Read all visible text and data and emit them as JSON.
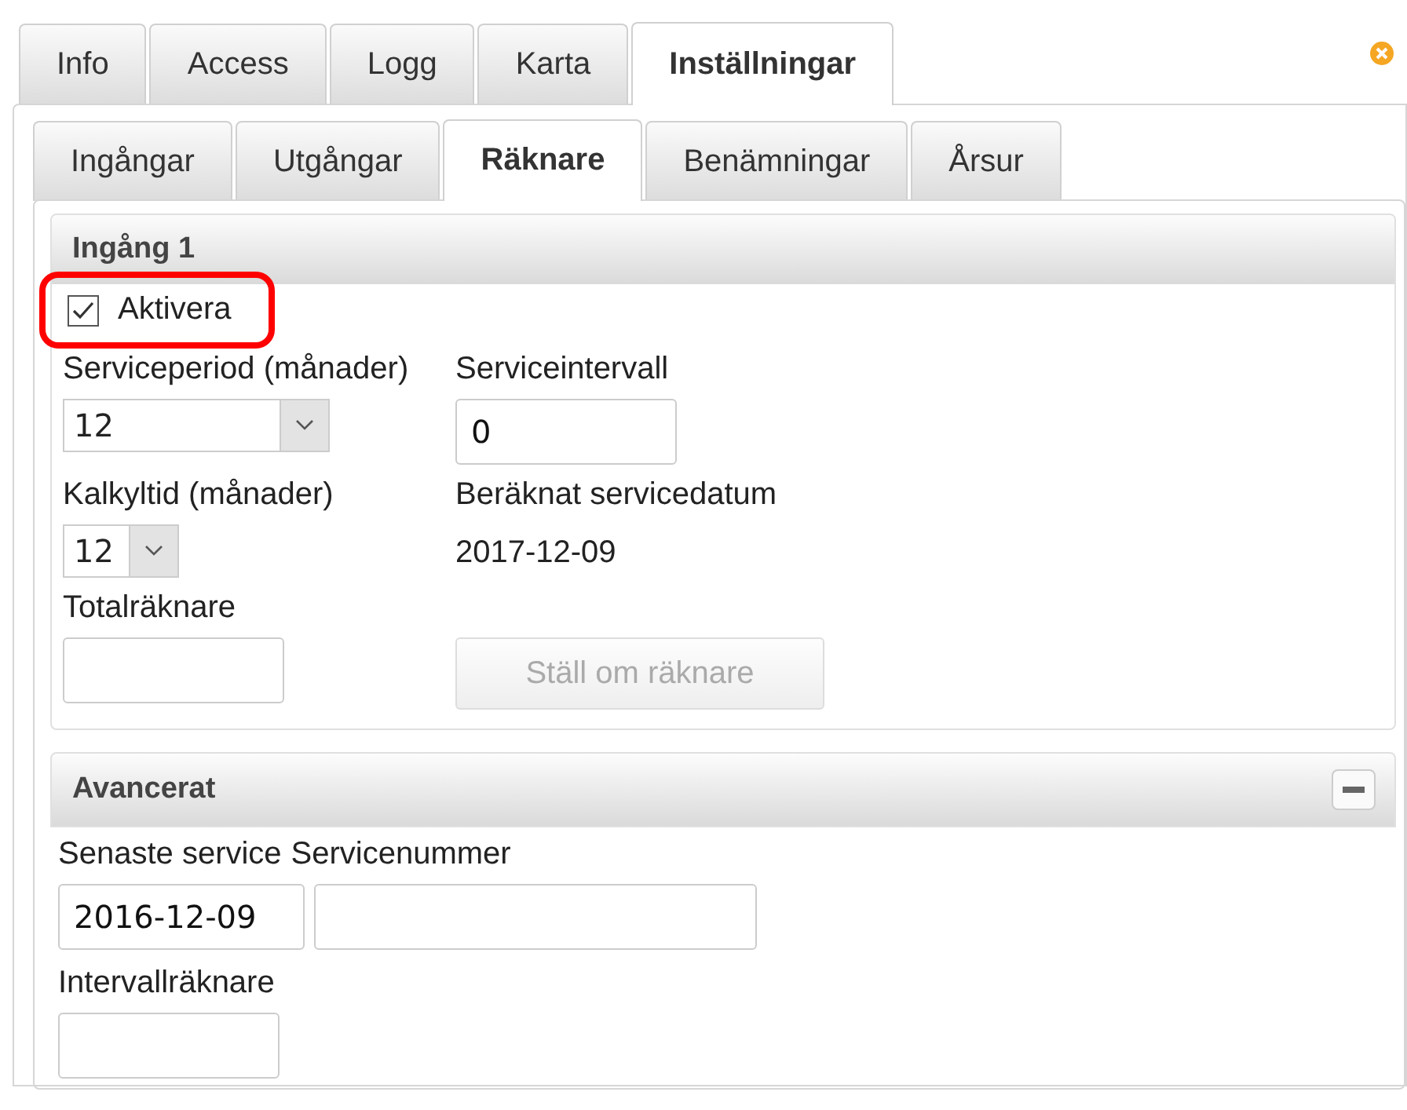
{
  "top_tabs": [
    {
      "label": "Info",
      "selected": false
    },
    {
      "label": "Access",
      "selected": false
    },
    {
      "label": "Logg",
      "selected": false
    },
    {
      "label": "Karta",
      "selected": false
    },
    {
      "label": "Inställningar",
      "selected": true
    }
  ],
  "sub_tabs": [
    {
      "label": "Ingångar",
      "selected": false
    },
    {
      "label": "Utgångar",
      "selected": false
    },
    {
      "label": "Räknare",
      "selected": true
    },
    {
      "label": "Benämningar",
      "selected": false
    },
    {
      "label": "Årsur",
      "selected": false
    }
  ],
  "input_section": {
    "title": "Ingång 1",
    "activate": {
      "label": "Aktivera",
      "checked": true,
      "highlighted": true
    },
    "service_period": {
      "label": "Serviceperiod (månader)",
      "value": "12"
    },
    "service_interval": {
      "label": "Serviceintervall",
      "value": "0"
    },
    "calc_time": {
      "label": "Kalkyltid (månader)",
      "value": "12"
    },
    "service_date": {
      "label": "Beräknat servicedatum",
      "value": "2017-12-09"
    },
    "total_counter": {
      "label": "Totalräknare"
    },
    "reset_button": {
      "label": "Ställ om räknare",
      "disabled": true
    }
  },
  "advanced": {
    "title": "Avancerat",
    "expanded": true,
    "last_service": {
      "label": "Senaste service",
      "value": "2016-12-09"
    },
    "service_number": {
      "label": "Servicenummer"
    },
    "interval_counter": {
      "label": "Intervallräknare"
    }
  }
}
